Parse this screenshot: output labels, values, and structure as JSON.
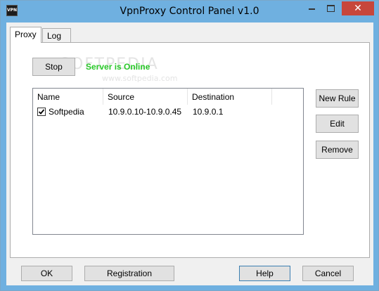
{
  "window": {
    "title": "VpnProxy Control Panel v1.0",
    "icon_text": "VPN",
    "close_glyph": "✕"
  },
  "tabs": [
    {
      "label": "Proxy",
      "selected": true
    },
    {
      "label": "Log",
      "selected": false
    }
  ],
  "proxy": {
    "stop_label": "Stop",
    "status_text": "Server is Online",
    "status_color": "#28c828",
    "watermark": "SOFTPEDIA",
    "watermark_url": "www.softpedia.com",
    "columns": [
      "Name",
      "Source",
      "Destination"
    ],
    "rows": [
      {
        "checked": true,
        "name": "Softpedia",
        "source": "10.9.0.10-10.9.0.45",
        "destination": "10.9.0.1"
      }
    ],
    "side_buttons": {
      "new_rule": "New Rule",
      "edit": "Edit",
      "remove": "Remove"
    }
  },
  "footer": {
    "ok": "OK",
    "registration": "Registration",
    "help": "Help",
    "cancel": "Cancel"
  }
}
